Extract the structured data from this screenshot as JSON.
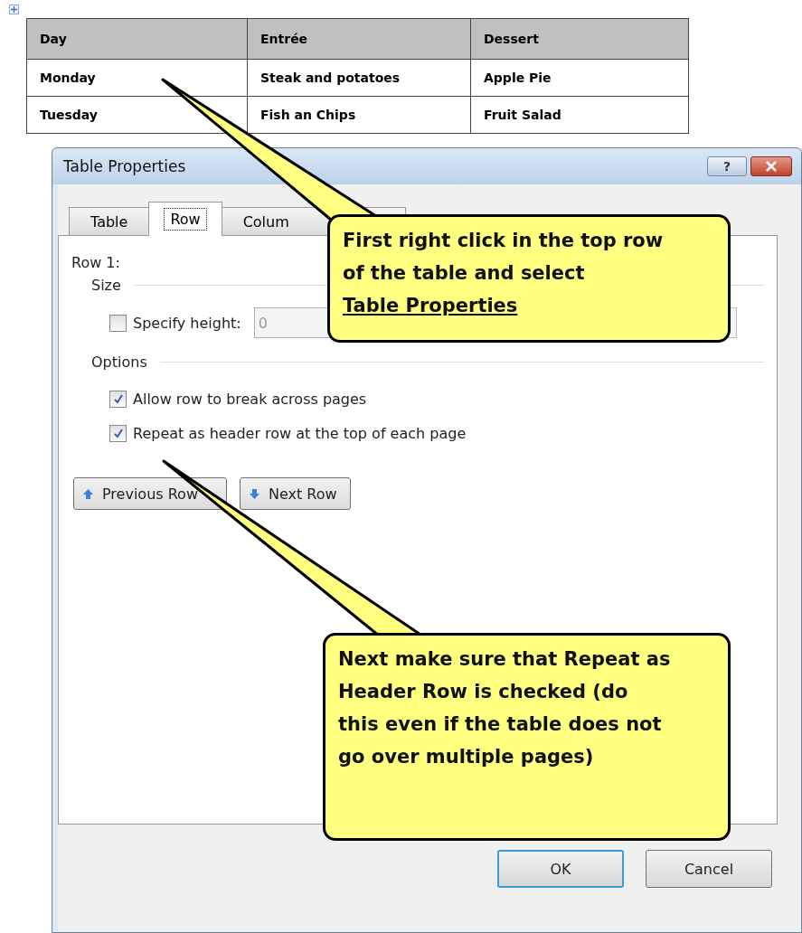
{
  "document_table": {
    "columns": [
      "Day",
      "Entrée",
      "Dessert"
    ],
    "rows": [
      [
        "Monday",
        "Steak and potatoes",
        "Apple Pie"
      ],
      [
        "Tuesday",
        "Fish an Chips",
        "Fruit Salad"
      ]
    ]
  },
  "dialog": {
    "title": "Table Properties",
    "help_button": "?",
    "tabs": [
      {
        "label": "Table",
        "selected": false
      },
      {
        "label": "Row",
        "selected": true
      },
      {
        "label": "Colum",
        "selected": false
      }
    ],
    "row_label": "Row 1:",
    "size_section": "Size",
    "specify_height": {
      "label": "Specify height:",
      "checked": false,
      "value": "0"
    },
    "options_section": "Options",
    "options": [
      {
        "label": "Allow row to break across pages",
        "checked": true
      },
      {
        "label": "Repeat as header row at the top of each page",
        "checked": true
      }
    ],
    "nav_buttons": [
      {
        "label": "Previous Row",
        "kind": "previous"
      },
      {
        "label": "Next Row",
        "kind": "next"
      }
    ],
    "buttons": [
      {
        "label": "OK",
        "default": true
      },
      {
        "label": "Cancel",
        "default": false
      }
    ]
  },
  "callouts": [
    {
      "text": "First right click in the top row of the table and select",
      "link": "Table Properties"
    },
    {
      "text": "Next make sure that Repeat as Header Row is checked (do this even if the table does not go over multiple pages)"
    }
  ]
}
